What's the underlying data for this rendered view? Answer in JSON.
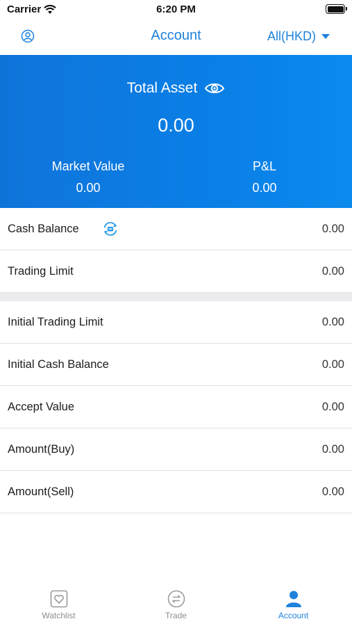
{
  "status_bar": {
    "carrier": "Carrier",
    "time": "6:20 PM"
  },
  "nav": {
    "title": "Account",
    "currency": "All(HKD)"
  },
  "summary": {
    "total_asset_label": "Total Asset",
    "total_asset_value": "0.00",
    "market_value_label": "Market Value",
    "market_value": "0.00",
    "pnl_label": "P&L",
    "pnl_value": "0.00"
  },
  "section1": [
    {
      "label": "Cash Balance",
      "value": "0.00"
    },
    {
      "label": "Trading Limit",
      "value": "0.00"
    }
  ],
  "section2": [
    {
      "label": "Initial Trading Limit",
      "value": "0.00"
    },
    {
      "label": "Initial Cash Balance",
      "value": "0.00"
    },
    {
      "label": "Accept Value",
      "value": "0.00"
    },
    {
      "label": "Amount(Buy)",
      "value": "0.00"
    },
    {
      "label": "Amount(Sell)",
      "value": "0.00"
    }
  ],
  "tabs": [
    {
      "label": "Watchlist",
      "icon": "heart-icon",
      "active": false
    },
    {
      "label": "Trade",
      "icon": "exchange-icon",
      "active": false
    },
    {
      "label": "Account",
      "icon": "person-icon",
      "active": true
    }
  ],
  "colors": {
    "accent": "#1e82dc",
    "panel": "#0a7fe6",
    "inactive": "#8e8e93",
    "divider": "#ececef"
  }
}
